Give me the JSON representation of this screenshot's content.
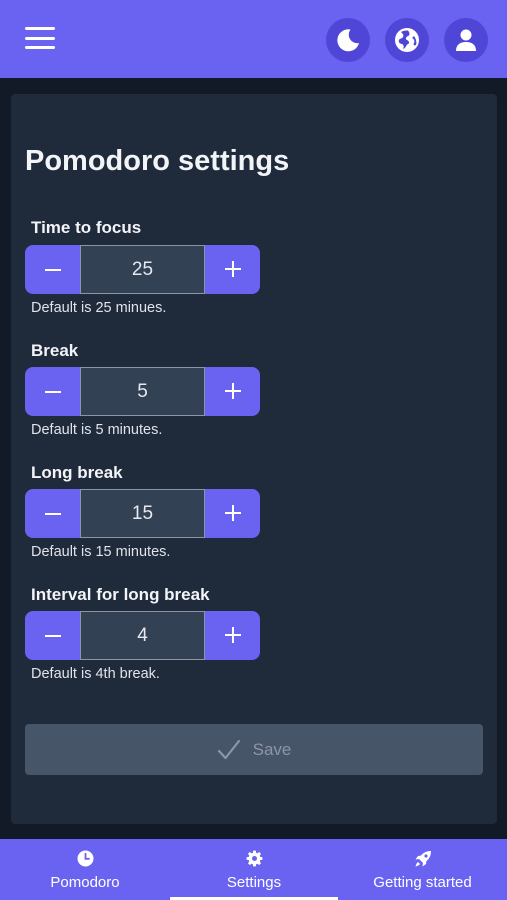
{
  "header": {
    "menu_icon": "hamburger-menu-icon",
    "actions": [
      {
        "name": "theme-toggle",
        "icon": "moon-icon"
      },
      {
        "name": "language",
        "icon": "globe-icon"
      },
      {
        "name": "account",
        "icon": "user-icon"
      }
    ]
  },
  "settings": {
    "title": "Pomodoro settings",
    "fields": [
      {
        "label": "Time to focus",
        "value": "25",
        "hint": "Default is 25 minues."
      },
      {
        "label": "Break",
        "value": "5",
        "hint": "Default is 5 minutes."
      },
      {
        "label": "Long break",
        "value": "15",
        "hint": "Default is 15 minutes."
      },
      {
        "label": "Interval for long break",
        "value": "4",
        "hint": "Default is 4th break."
      }
    ],
    "save_label": "Save",
    "save_icon": "check-icon",
    "save_enabled": false
  },
  "bottom_nav": {
    "items": [
      {
        "label": "Pomodoro",
        "icon": "clock-icon"
      },
      {
        "label": "Settings",
        "icon": "gear-icon",
        "active": true
      },
      {
        "label": "Getting started",
        "icon": "rocket-icon"
      }
    ]
  },
  "colors": {
    "accent": "#6a63f1",
    "accent_dark": "#4f46d8",
    "page_bg": "#111a26",
    "card_bg": "#1f2a3b",
    "input_bg": "#334155",
    "disabled_button": "#475569"
  }
}
